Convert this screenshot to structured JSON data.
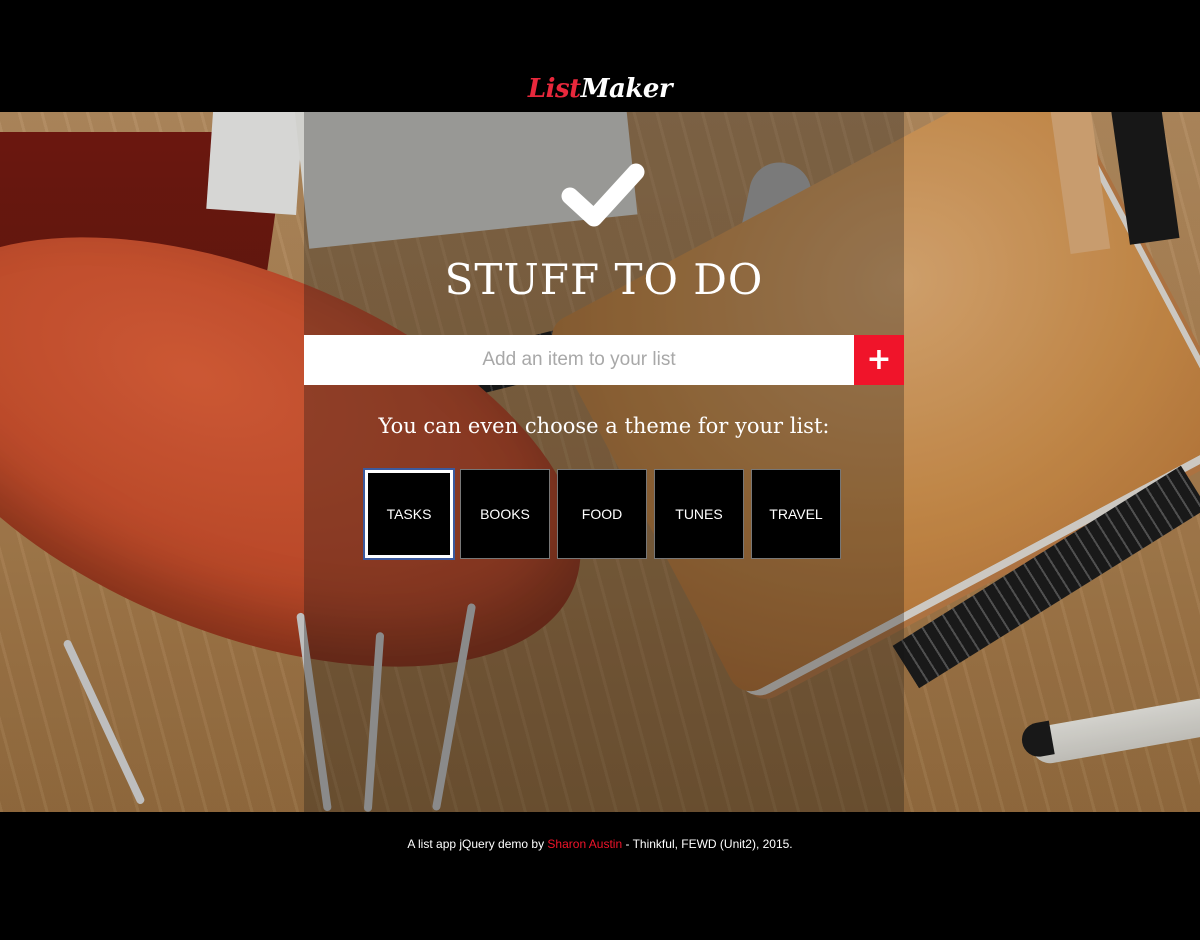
{
  "header": {
    "logo_part1": "List",
    "logo_part2": "Maker"
  },
  "main": {
    "title": "STUFF TO DO",
    "add_input": {
      "placeholder": "Add an item to your list",
      "value": ""
    },
    "add_button_label": "+",
    "theme_prompt": "You can even choose a theme for your list:",
    "themes": [
      {
        "label": "TASKS",
        "selected": true
      },
      {
        "label": "BOOKS",
        "selected": false
      },
      {
        "label": "FOOD",
        "selected": false
      },
      {
        "label": "TUNES",
        "selected": false
      },
      {
        "label": "TRAVEL",
        "selected": false
      }
    ]
  },
  "footer": {
    "prefix": "A list app jQuery demo by ",
    "author": "Sharon Austin",
    "suffix": " - Thinkful, FEWD (Unit2), 2015."
  },
  "colors": {
    "accent": "#f0142a",
    "logo_red": "#e8283c",
    "selected_outline": "#3c5a9e"
  },
  "icons": {
    "hero": "checkmark-icon",
    "add": "plus-icon"
  }
}
